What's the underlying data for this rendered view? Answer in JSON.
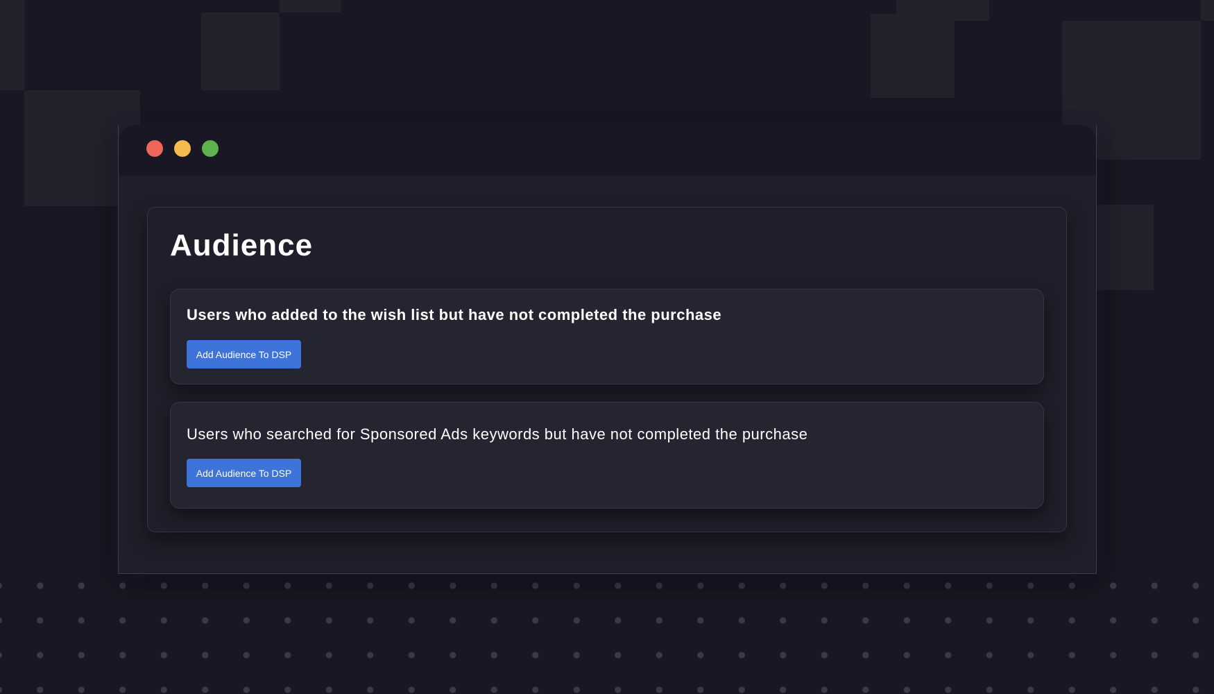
{
  "page": {
    "title": "Audience"
  },
  "audiences": [
    {
      "title": "Users who added to the wish list but have not completed the purchase",
      "button_label": "Add Audience To DSP"
    },
    {
      "title": "Users who searched for Sponsored Ads keywords but have not completed the purchase",
      "button_label": "Add Audience To DSP"
    }
  ],
  "colors": {
    "background": "#181723",
    "window": "#1f1e2a",
    "card": "#252431",
    "accent_button": "#3e73da",
    "close": "#f0655a",
    "minimize": "#f5bc4d",
    "maximize": "#5eb14d"
  },
  "icons": {
    "close": "close-window-icon",
    "minimize": "minimize-window-icon",
    "maximize": "maximize-window-icon"
  }
}
